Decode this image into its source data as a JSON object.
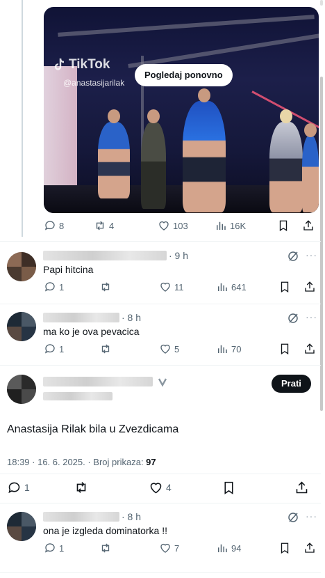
{
  "video": {
    "watermark_brand": "TikTok",
    "watermark_user": "@anastasijarilak",
    "replay_label": "Pogledaj ponovno"
  },
  "tweet_actions": {
    "replies": "8",
    "reposts": "4",
    "likes": "103",
    "views": "16K"
  },
  "replies": [
    {
      "time": "· 9 h",
      "text": "Papi hitcina",
      "counts": {
        "replies": "1",
        "reposts": "",
        "likes": "11",
        "views": "641"
      }
    },
    {
      "time": "· 8 h",
      "text": "ma ko je ova pevacica",
      "counts": {
        "replies": "1",
        "reposts": "",
        "likes": "5",
        "views": "70"
      }
    }
  ],
  "quoted_post": {
    "follow_label": "Prati",
    "text": "Anastasija Rilak bila u Zvezdicama",
    "date": "18:39 · 16. 6. 2025. · Broj prikaza: ",
    "views": "97",
    "counts": {
      "replies": "1",
      "likes": "4"
    }
  },
  "last_reply": {
    "time": "· 8 h",
    "text": "ona je izgleda dominatorka !!",
    "counts": {
      "replies": "1",
      "reposts": "",
      "likes": "7",
      "views": "94"
    }
  },
  "icons": [
    "reply-icon",
    "repost-icon",
    "like-icon",
    "views-icon",
    "bookmark-icon",
    "share-icon",
    "grok-icon",
    "more-icon",
    "verified-icon"
  ],
  "colors": {
    "muted": "#536471",
    "text": "#0f1419",
    "follow_bg": "#0f1419"
  }
}
